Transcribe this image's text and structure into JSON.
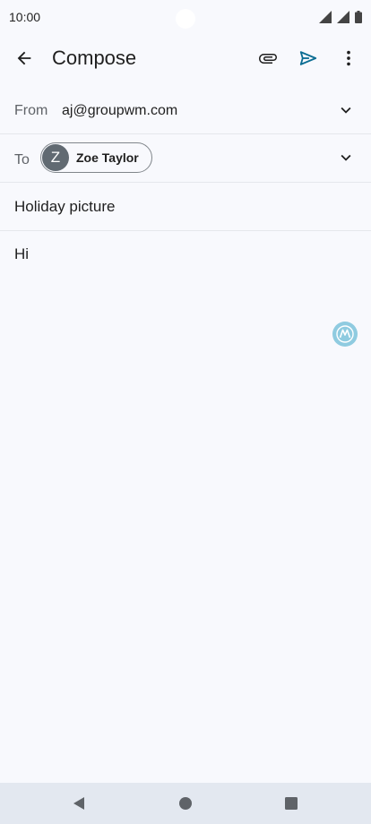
{
  "status_bar": {
    "time": "10:00"
  },
  "app_bar": {
    "title": "Compose",
    "send_accent": "#0b6d93"
  },
  "compose": {
    "from_label": "From",
    "from_value": "aj@groupwm.com",
    "to_label": "To",
    "recipient": {
      "initial": "Z",
      "name": "Zoe Taylor"
    },
    "subject": "Holiday picture",
    "body": "Hi"
  },
  "icons": [
    "back-arrow-icon",
    "paperclip-icon",
    "send-icon",
    "more-vert-icon",
    "chevron-down-icon",
    "motorola-logo-icon",
    "nav-back-icon",
    "nav-home-icon",
    "nav-recents-icon"
  ]
}
